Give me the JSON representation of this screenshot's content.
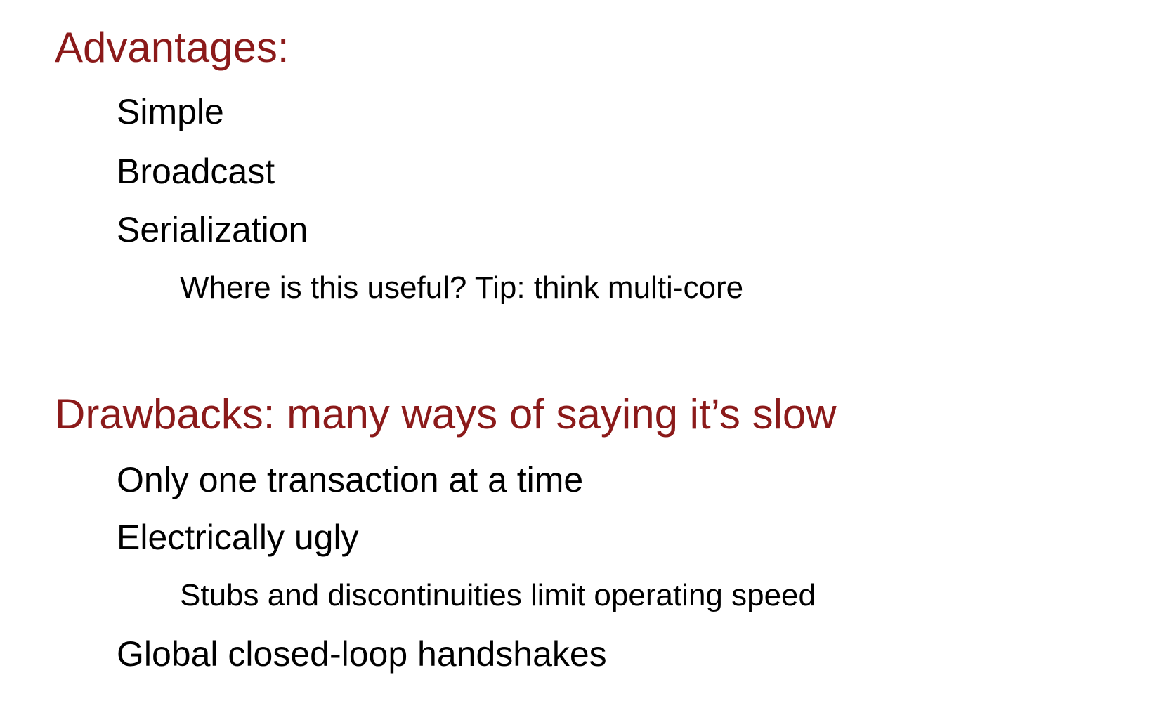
{
  "colors": {
    "heading": "#8b1a1a",
    "body_text": "#000000",
    "background": "#ffffff"
  },
  "advantages": {
    "heading": "Advantages:",
    "items": [
      "Simple",
      "Broadcast",
      "Serialization"
    ],
    "sub_item": "Where is this useful? Tip: think multi-core"
  },
  "drawbacks": {
    "heading": "Drawbacks: many ways of saying it’s slow",
    "items": [
      "Only one transaction at a time",
      "Electrically ugly",
      "Global closed-loop handshakes"
    ],
    "sub_item": "Stubs and discontinuities limit operating speed"
  }
}
